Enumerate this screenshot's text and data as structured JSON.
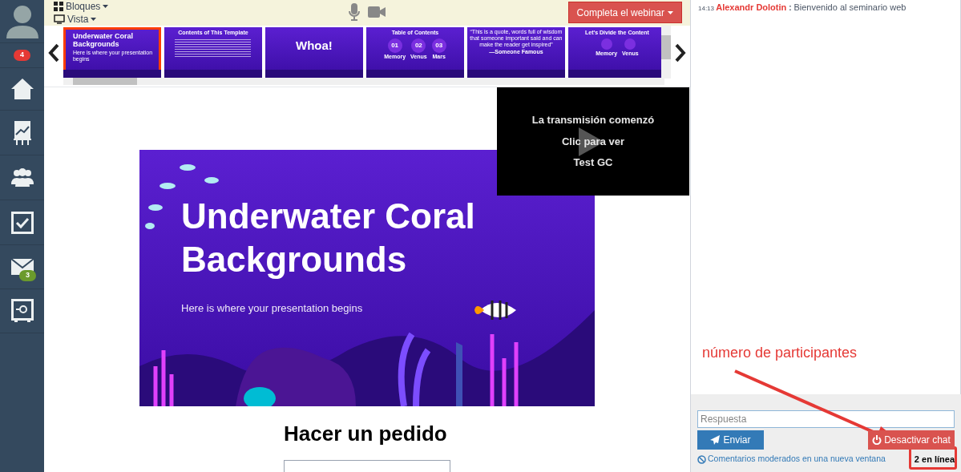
{
  "sidebar": {
    "items": [
      {
        "kind": "avatar"
      },
      {
        "kind": "notifications",
        "badge": "4"
      },
      {
        "kind": "home"
      },
      {
        "kind": "chart"
      },
      {
        "kind": "people"
      },
      {
        "kind": "tasks"
      },
      {
        "kind": "mail",
        "badge": "3"
      },
      {
        "kind": "safe"
      }
    ]
  },
  "toolbar": {
    "blocks_menu": "Bloques",
    "view_menu": "Vista",
    "finish_button": "Completa el webinar"
  },
  "slides": [
    {
      "kind": "title",
      "selected": true,
      "title": "Underwater Coral Backgrounds",
      "subtitle": "Here is where your presentation begins"
    },
    {
      "kind": "contents",
      "selected": false,
      "title": "Contents of This Template"
    },
    {
      "kind": "big",
      "selected": false,
      "title": "Whoa!"
    },
    {
      "kind": "toc",
      "selected": false,
      "title": "Table of Contents",
      "numbers": [
        "01",
        "02",
        "03"
      ],
      "labels": [
        "Memory",
        "Venus",
        "Mars"
      ]
    },
    {
      "kind": "quote",
      "selected": false,
      "quote": "“This is a quote, words full of wisdom that someone important said and can make the reader get inspired”",
      "author": "—Someone Famous"
    },
    {
      "kind": "divide",
      "selected": false,
      "title": "Let's Divide the Content",
      "labels": [
        "Memory",
        "Venus"
      ]
    }
  ],
  "current_slide": {
    "title": "Underwater Coral Backgrounds",
    "subtitle": "Here is where your presentation begins"
  },
  "stream": {
    "lines": [
      "La transmisión comenzó",
      "Clic para ver",
      "Test GC"
    ]
  },
  "order": {
    "heading": "Hacer un pedido"
  },
  "chat": {
    "messages": [
      {
        "time": "14:13",
        "author": "Alexandr Dolotin",
        "separator": ":",
        "text": "Bienvenido al seminario web"
      }
    ],
    "reply_placeholder": "Respuesta",
    "send_button": "Enviar",
    "disable_button": "Desactivar chat",
    "moderated_link": "Comentarios moderados en una nueva ventana",
    "online": "2 en línea"
  },
  "annotation": {
    "label": "número de participantes"
  }
}
